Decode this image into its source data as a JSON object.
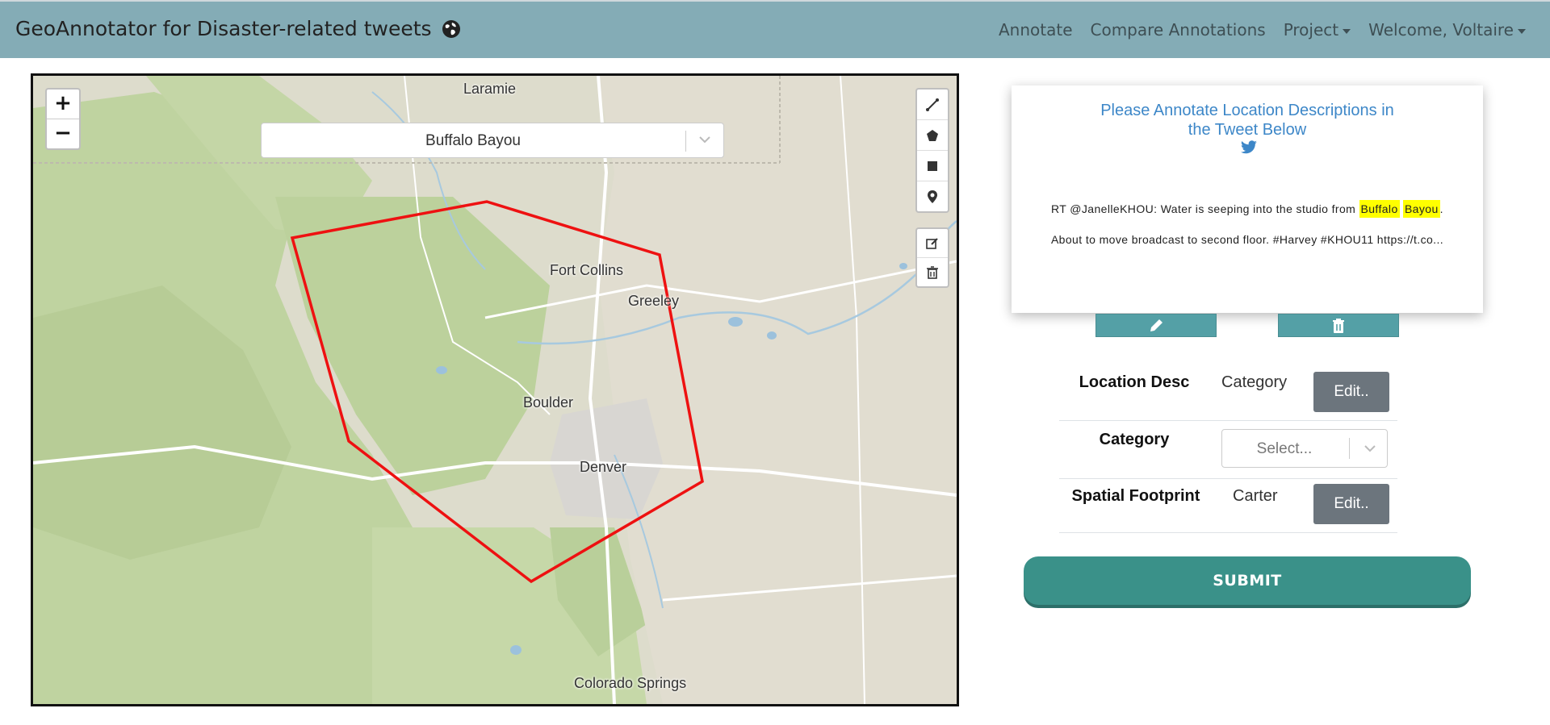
{
  "navbar": {
    "brand": "GeoAnnotator for Disaster-related tweets",
    "globe_icon": "globe-icon",
    "links": {
      "annotate": "Annotate",
      "compare": "Compare Annotations",
      "project": "Project",
      "welcome": "Welcome, Voltaire"
    }
  },
  "map": {
    "search_value": "Buffalo Bayou",
    "zoom_in": "+",
    "zoom_out": "−",
    "cities": {
      "laramie": "Laramie",
      "fort_collins": "Fort Collins",
      "greeley": "Greeley",
      "boulder": "Boulder",
      "denver": "Denver",
      "colorado_springs": "Colorado Springs"
    },
    "polygon_color": "#ee1111",
    "draw_tools": [
      "polyline-icon",
      "polygon-icon",
      "rectangle-icon",
      "marker-icon"
    ],
    "edit_tools": [
      "edit-layers-icon",
      "delete-layers-icon"
    ]
  },
  "tweet_card": {
    "title": "Please Annotate Location Descriptions in the Tweet Below",
    "tweet_before": "RT @JanelleKHOU: Water is seeping into the studio from ",
    "tweet_highlight_1": "Buffalo",
    "tweet_highlight_2": "Bayou",
    "tweet_after": ". About to move broadcast to second floor. #Harvey #KHOU11 https://t.co...",
    "title_color": "#3d87c8",
    "highlight_color": "#ffff00"
  },
  "annotation_form": {
    "location_desc_label": "Location Desc",
    "location_desc_value": "Category",
    "category_label": "Category",
    "category_placeholder": "Select...",
    "spatial_label": "Spatial Footprint",
    "spatial_value": "Carter",
    "edit_label": "Edit.."
  },
  "submit_label": "SUBMIT"
}
